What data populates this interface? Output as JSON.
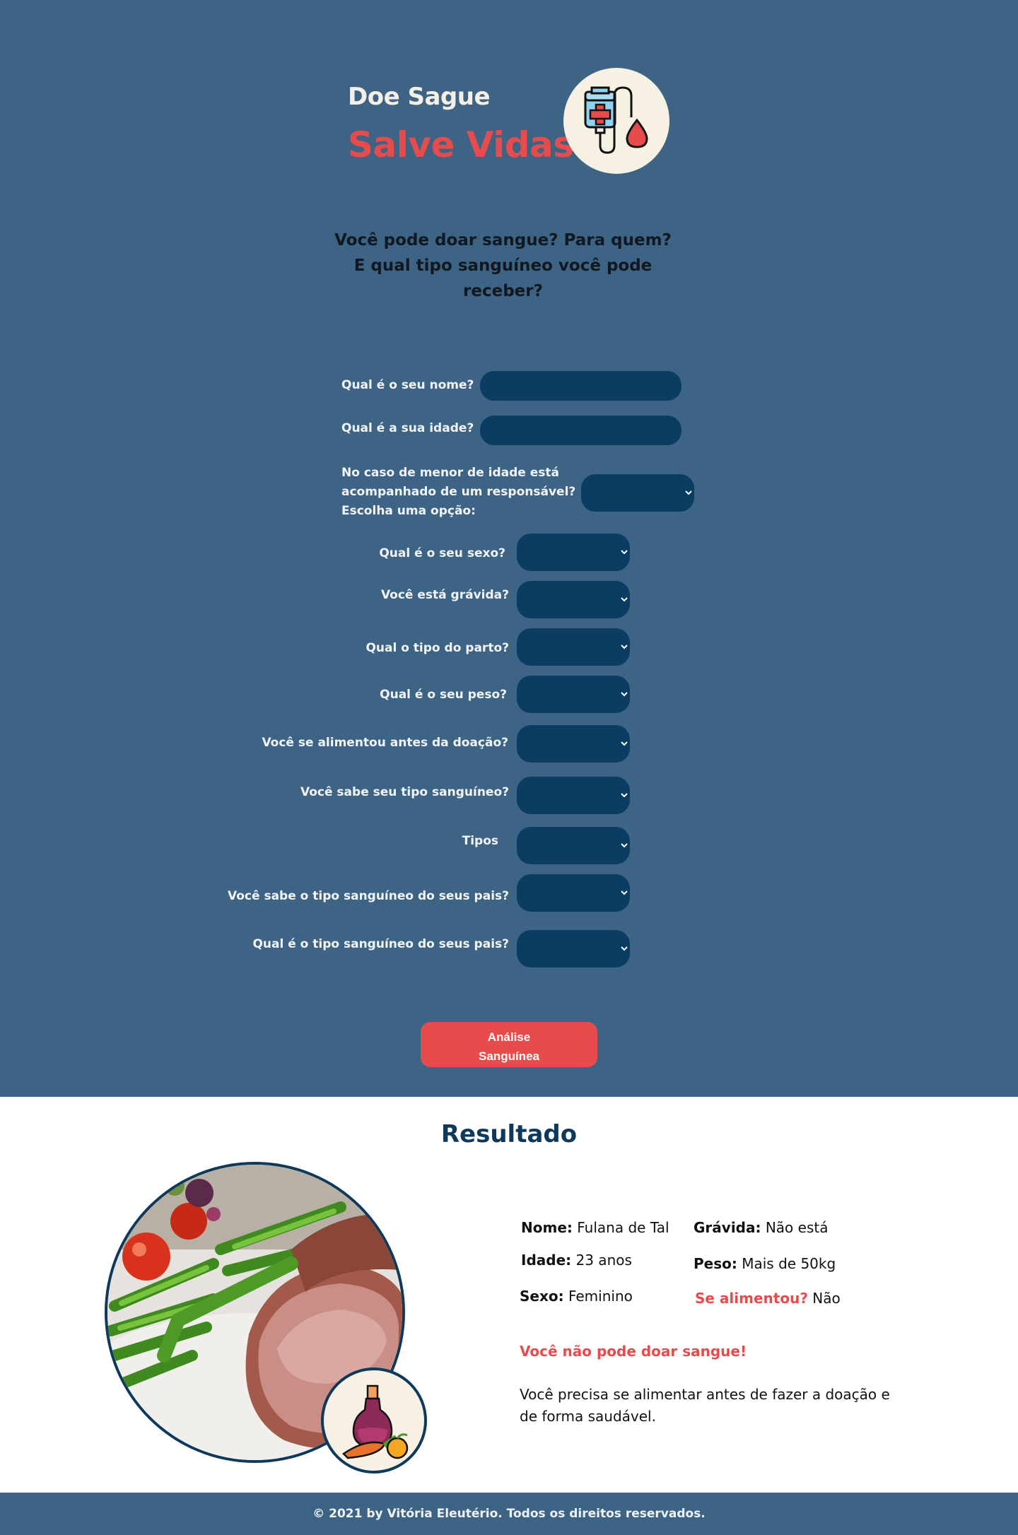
{
  "hero": {
    "line1": "Doe Sague",
    "line2": "Salve Vidas",
    "badge_icon": "blood-bag-icon"
  },
  "question": {
    "line1": "Você pode doar sangue? Para quem?",
    "line2": "E qual tipo sanguíneo você pode",
    "line3": "receber?"
  },
  "form": {
    "name_label": "Qual é o seu nome?",
    "age_label": "Qual é a sua idade?",
    "minor_label_1": "No caso de menor de idade está",
    "minor_label_2": "acompanhado de um responsável?",
    "minor_label_3": "Escolha uma opção:",
    "sex_label": "Qual é o seu sexo?",
    "pregnant_label": "Você está grávida?",
    "birth_label": "Qual o tipo do parto?",
    "weight_label": "Qual é o seu peso?",
    "fed_label": "Você se alimentou antes da doação?",
    "knows_type_label": "Você sabe seu tipo sanguíneo?",
    "types_label": "Tipos",
    "knows_parents_label": "Você sabe o tipo sanguíneo do seus pais?",
    "parents_type_label": "Qual é o tipo sanguíneo do seus pais?",
    "submit_line1": "Análise",
    "submit_line2": "Sanguínea"
  },
  "result": {
    "title": "Resultado",
    "name_key": "Nome:",
    "name_value": "Fulana de Tal",
    "age_key": "Idade:",
    "age_value": "23 anos",
    "sex_key": "Sexo:",
    "sex_value": "Feminino",
    "pregnant_key": "Grávida:",
    "pregnant_value": "Não está",
    "weight_key": "Peso:",
    "weight_value": "Mais de 50kg",
    "fed_key": "Se alimentou?",
    "fed_value": "Não",
    "verdict": "Você não pode doar sangue!",
    "advice": "Você precisa se alimentar antes de fazer a doação e de forma saudável.",
    "photo_icon": "food-plate-image",
    "badge_icon": "healthy-food-icon"
  },
  "footer": {
    "text": "© 2021 by Vitória Eleutério. Todos os direitos reservados."
  },
  "colors": {
    "background": "#3d6485",
    "field": "#0b3c62",
    "accent": "#e84b4b",
    "dark_blue": "#0d3a5c",
    "cream": "#f7f1e3"
  }
}
